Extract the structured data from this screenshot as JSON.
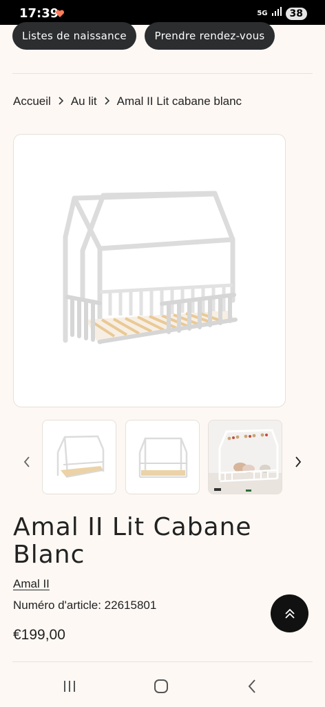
{
  "status": {
    "time": "17:39",
    "network": "5G",
    "battery": "38"
  },
  "top_actions": {
    "birth_lists": "Listes de naissance",
    "appointment": "Prendre rendez-vous"
  },
  "breadcrumb": {
    "home": "Accueil",
    "category": "Au lit",
    "current": "Amal II Lit cabane blanc"
  },
  "product": {
    "title": "Amal II Lit Cabane Blanc",
    "brand": "Amal II",
    "sku_label": "Numéro d'article: 22615801",
    "price": "€199,00"
  },
  "icons": {
    "heart": "heart-icon",
    "signal": "signal-icon",
    "chevron_left": "chevron-left-icon",
    "chevron_right": "chevron-right-icon",
    "scroll_top": "double-chevron-up-icon",
    "recents": "recents-icon",
    "home": "home-icon",
    "back": "back-icon"
  },
  "colors": {
    "background": "#fdf8f4",
    "pill": "#2b2d2f",
    "fab": "#111111",
    "wood": "#e9c995"
  }
}
